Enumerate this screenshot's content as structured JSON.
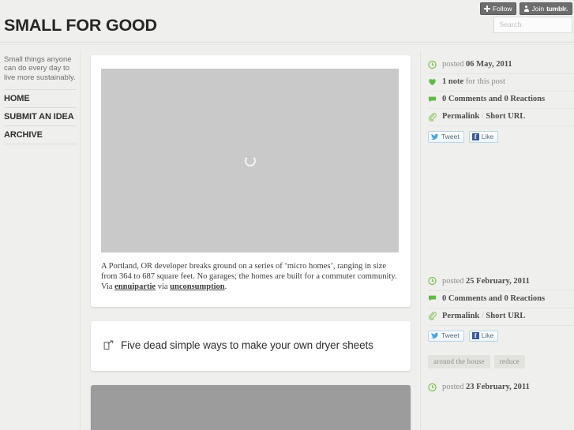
{
  "tumblr_controls": {
    "follow_label": "Follow",
    "join_label": "Join",
    "brand_label": "tumblr."
  },
  "search": {
    "placeholder": "Search",
    "value": "",
    "icon": "search-icon"
  },
  "header": {
    "title": "SMALL FOR GOOD"
  },
  "sidebar": {
    "description": "Small things anyone can do every day to live more sustainably.",
    "items": [
      {
        "label": "HOME"
      },
      {
        "label": "SUBMIT AN IDEA"
      },
      {
        "label": "ARCHIVE"
      }
    ]
  },
  "posts": [
    {
      "type": "photo",
      "image_state": "loading",
      "caption_lead": "A Portland, OR developer breaks ground on a series of ‘micro homes’, ranging in size from 364 to 687 square feet. No garages; the homes are built for a commuter community. Via ",
      "caption_link1": "ennuipartie",
      "caption_mid": " via ",
      "caption_link2": "unconsumption",
      "caption_end": ".",
      "meta": {
        "posted_label": "posted",
        "posted_date": "06 May, 2011",
        "notes_count": "1 note",
        "notes_suffix": "for this post",
        "comments": "0 Comments and 0 Reactions",
        "permalink": "Permalink",
        "separator": "/",
        "short_url": "Short URL",
        "tweet_label": "Tweet",
        "like_label": "Like"
      },
      "tags": []
    },
    {
      "type": "link",
      "title": "Five dead simple ways to make your own dryer sheets",
      "icon": "external-link-icon",
      "meta": {
        "posted_label": "posted",
        "posted_date": "25 February, 2011",
        "comments": "0 Comments and 0 Reactions",
        "permalink": "Permalink",
        "separator": "/",
        "short_url": "Short URL",
        "tweet_label": "Tweet",
        "like_label": "Like"
      },
      "tags": [
        "around the house",
        "reduce"
      ]
    },
    {
      "type": "quote",
      "meta": {
        "posted_label": "posted",
        "posted_date": "23 February, 2011"
      }
    }
  ],
  "colors": {
    "page_bg": "#efefed",
    "card_bg": "#ffffff",
    "accent_green": "#77c043",
    "photo_placeholder": "#c9c9c9",
    "quote_block": "#9c9c9c",
    "tag_bg": "#e2e2df",
    "tumblr_btn": "#6d6d6d"
  }
}
